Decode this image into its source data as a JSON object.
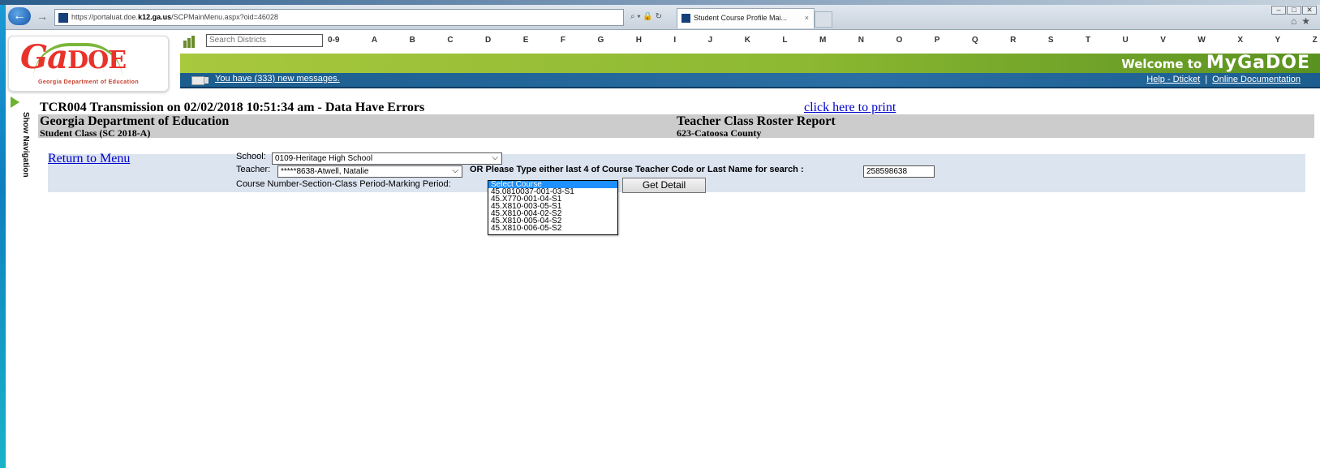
{
  "browser": {
    "url_prefix": "https://portaluat.doe.",
    "url_domain": "k12.ga.us",
    "url_path": "/SCPMainMenu.aspx?oid=46028",
    "tab_title": "Student Course Profile Mai...",
    "addr_tools": "⌕ ▾ 🔒 ↻",
    "tab_close": "×"
  },
  "header": {
    "logo_word": "Ga",
    "logo_doe": "DOE",
    "logo_tagline": "Georgia Department of Education",
    "search_placeholder": "Search Districts",
    "letters": [
      "0-9",
      "A",
      "B",
      "C",
      "D",
      "E",
      "F",
      "G",
      "H",
      "I",
      "J",
      "K",
      "L",
      "M",
      "N",
      "O",
      "P",
      "Q",
      "R",
      "S",
      "T",
      "U",
      "V",
      "W",
      "X",
      "Y",
      "Z"
    ],
    "welcome_small": "Welcome to",
    "welcome_big": "MyGaDOE",
    "messages_link": "You have (333) new messages.",
    "help_link": "Help - Dticket",
    "docs_link": "Online Documentation",
    "link_separator": "|"
  },
  "sidebar": {
    "show_navigation": "Show Navigation"
  },
  "report": {
    "title": "TCR004 Transmission on 02/02/2018 10:51:34 am - Data Have Errors",
    "print_link": "click here to print",
    "department": "Georgia Department of Education",
    "student_class": "Student Class (SC 2018-A)",
    "report_name": "Teacher Class Roster Report",
    "county": "623-Catoosa County"
  },
  "form": {
    "return_link": "Return to Menu",
    "school_label": "School:",
    "school_value": "0109-Heritage High School",
    "teacher_label": "Teacher:",
    "teacher_value": "*****8638-Atwell, Natalie",
    "search_hint": "OR Please Type either last 4 of Course Teacher Code or Last Name for search :",
    "search_value": "258598638",
    "course_label": "Course Number-Section-Class Period-Marking Period:",
    "get_detail": "Get Detail",
    "course_options": [
      "Select Course",
      "45.0810037-001-03-S1",
      "45.X770-001-04-S1",
      "45.X810-003-05-S1",
      "45.X810-004-02-S2",
      "45.X810-005-04-S2",
      "45.X810-006-05-S2"
    ],
    "selected_index": 0
  }
}
